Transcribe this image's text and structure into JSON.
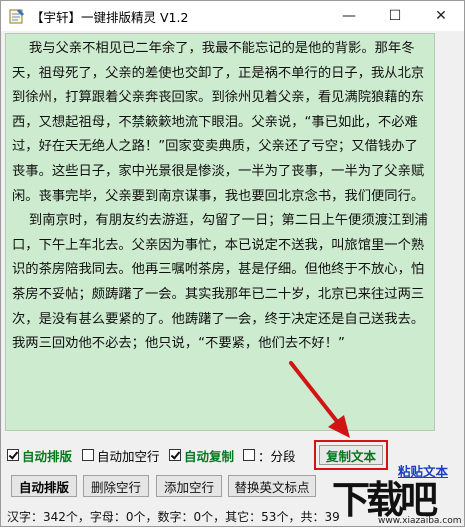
{
  "window": {
    "title": "【宇轩】一键排版精灵 V1.2",
    "minimize_glyph": "—",
    "maximize_glyph": "☐",
    "close_glyph": "✕"
  },
  "editor": {
    "text": "    我与父亲不相见已二年余了，我最不能忘记的是他的背影。那年冬天，祖母死了，父亲的差使也交卸了，正是祸不单行的日子，我从北京到徐州，打算跟着父亲奔丧回家。到徐州见着父亲，看见满院狼藉的东西，又想起祖母，不禁簌簌地流下眼泪。父亲说，“事已如此，不必难过，好在天无绝人之路！”回家变卖典质，父亲还了亏空；又借钱办了丧事。这些日子，家中光景很是惨淡，一半为了丧事，一半为了父亲赋闲。丧事完毕，父亲要到南京谋事，我也要回北京念书，我们便同行。\n    到南京时，有朋友约去游逛，勾留了一日；第二日上午便须渡江到浦口，下午上车北去。父亲因为事忙，本已说定不送我，叫旅馆里一个熟识的茶房陪我同去。他再三嘱咐茶房，甚是仔细。但他终于不放心，怕茶房不妥帖；颇踌躇了一会。其实我那年已二十岁，北京已来往过两三次，是没有甚么要紧的了。他踌躇了一会，终于决定还是自己送我去。我两三回劝他不必去；他只说，“不要紧，他们去不好！”"
  },
  "options": {
    "auto_format": {
      "label": "自动排版",
      "checked": true
    },
    "auto_blank_line": {
      "label": "自动加空行",
      "checked": false
    },
    "auto_copy": {
      "label": "自动复制",
      "checked": true
    },
    "segment": {
      "label": "：分段",
      "checked": false
    }
  },
  "buttons": {
    "copy_text": "复制文本",
    "paste_text": "粘贴文本",
    "auto_format": "自动排版",
    "delete_blank": "删除空行",
    "add_blank": "添加空行",
    "replace_punct": "替换英文标点"
  },
  "status": {
    "text": "汉字：342个，字母：0个，数字：0个，其它：53个，共：39"
  },
  "watermark": {
    "main": "下载吧",
    "sub": "www.xiazaiba.com"
  },
  "colors": {
    "editor_bg": "#cdebcf",
    "highlight_red": "#d31414",
    "green_text": "#007a1c",
    "link_blue": "#1a3fc4"
  }
}
